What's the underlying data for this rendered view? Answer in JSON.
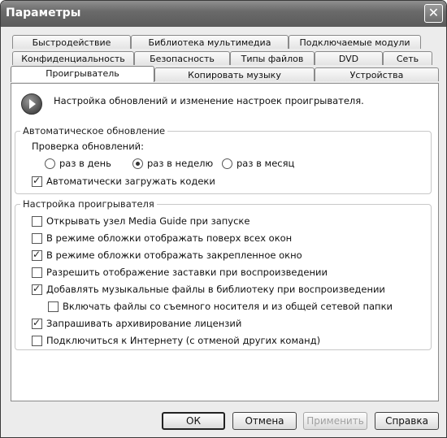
{
  "window": {
    "title": "Параметры",
    "close_glyph": "✕"
  },
  "tabs": {
    "row1": [
      "Быстродействие",
      "Библиотека мультимедиа",
      "Подключаемые модули"
    ],
    "row2": [
      "Конфиденциальность",
      "Безопасность",
      "Типы файлов",
      "DVD",
      "Сеть"
    ],
    "row3": [
      "Проигрыватель",
      "Копировать музыку",
      "Устройства"
    ],
    "active": "Проигрыватель"
  },
  "header": {
    "icon": "play-icon",
    "text": "Настройка обновлений и изменение настроек проигрывателя."
  },
  "auto_update": {
    "title": "Автоматическое обновление",
    "check_label": "Проверка обновлений:",
    "options": [
      {
        "label": "раз в день",
        "selected": false
      },
      {
        "label": "раз в неделю",
        "selected": true
      },
      {
        "label": "раз в месяц",
        "selected": false
      }
    ],
    "codecs": {
      "label": "Автоматически загружать кодеки",
      "checked": true
    }
  },
  "player_settings": {
    "title": "Настройка проигрывателя",
    "items": [
      {
        "label": "Открывать узел Media Guide при запуске",
        "checked": false
      },
      {
        "label": "В режиме обложки отображать поверх всех окон",
        "checked": false
      },
      {
        "label": "В режиме обложки отображать закрепленное окно",
        "checked": true
      },
      {
        "label": "Разрешить отображение заставки при воспроизведении",
        "checked": false
      },
      {
        "label": "Добавлять музыкальные файлы в библиотеку при воспроизведении",
        "checked": true
      },
      {
        "label": "Включать файлы со съемного носителя и из общей сетевой папки",
        "checked": false
      },
      {
        "label": "Запрашивать архивирование лицензий",
        "checked": true
      },
      {
        "label": "Подключиться к Интернету (с отменой других команд)",
        "checked": false
      }
    ]
  },
  "buttons": {
    "ok": "ОК",
    "cancel": "Отмена",
    "apply": "Применить",
    "help": "Справка"
  }
}
